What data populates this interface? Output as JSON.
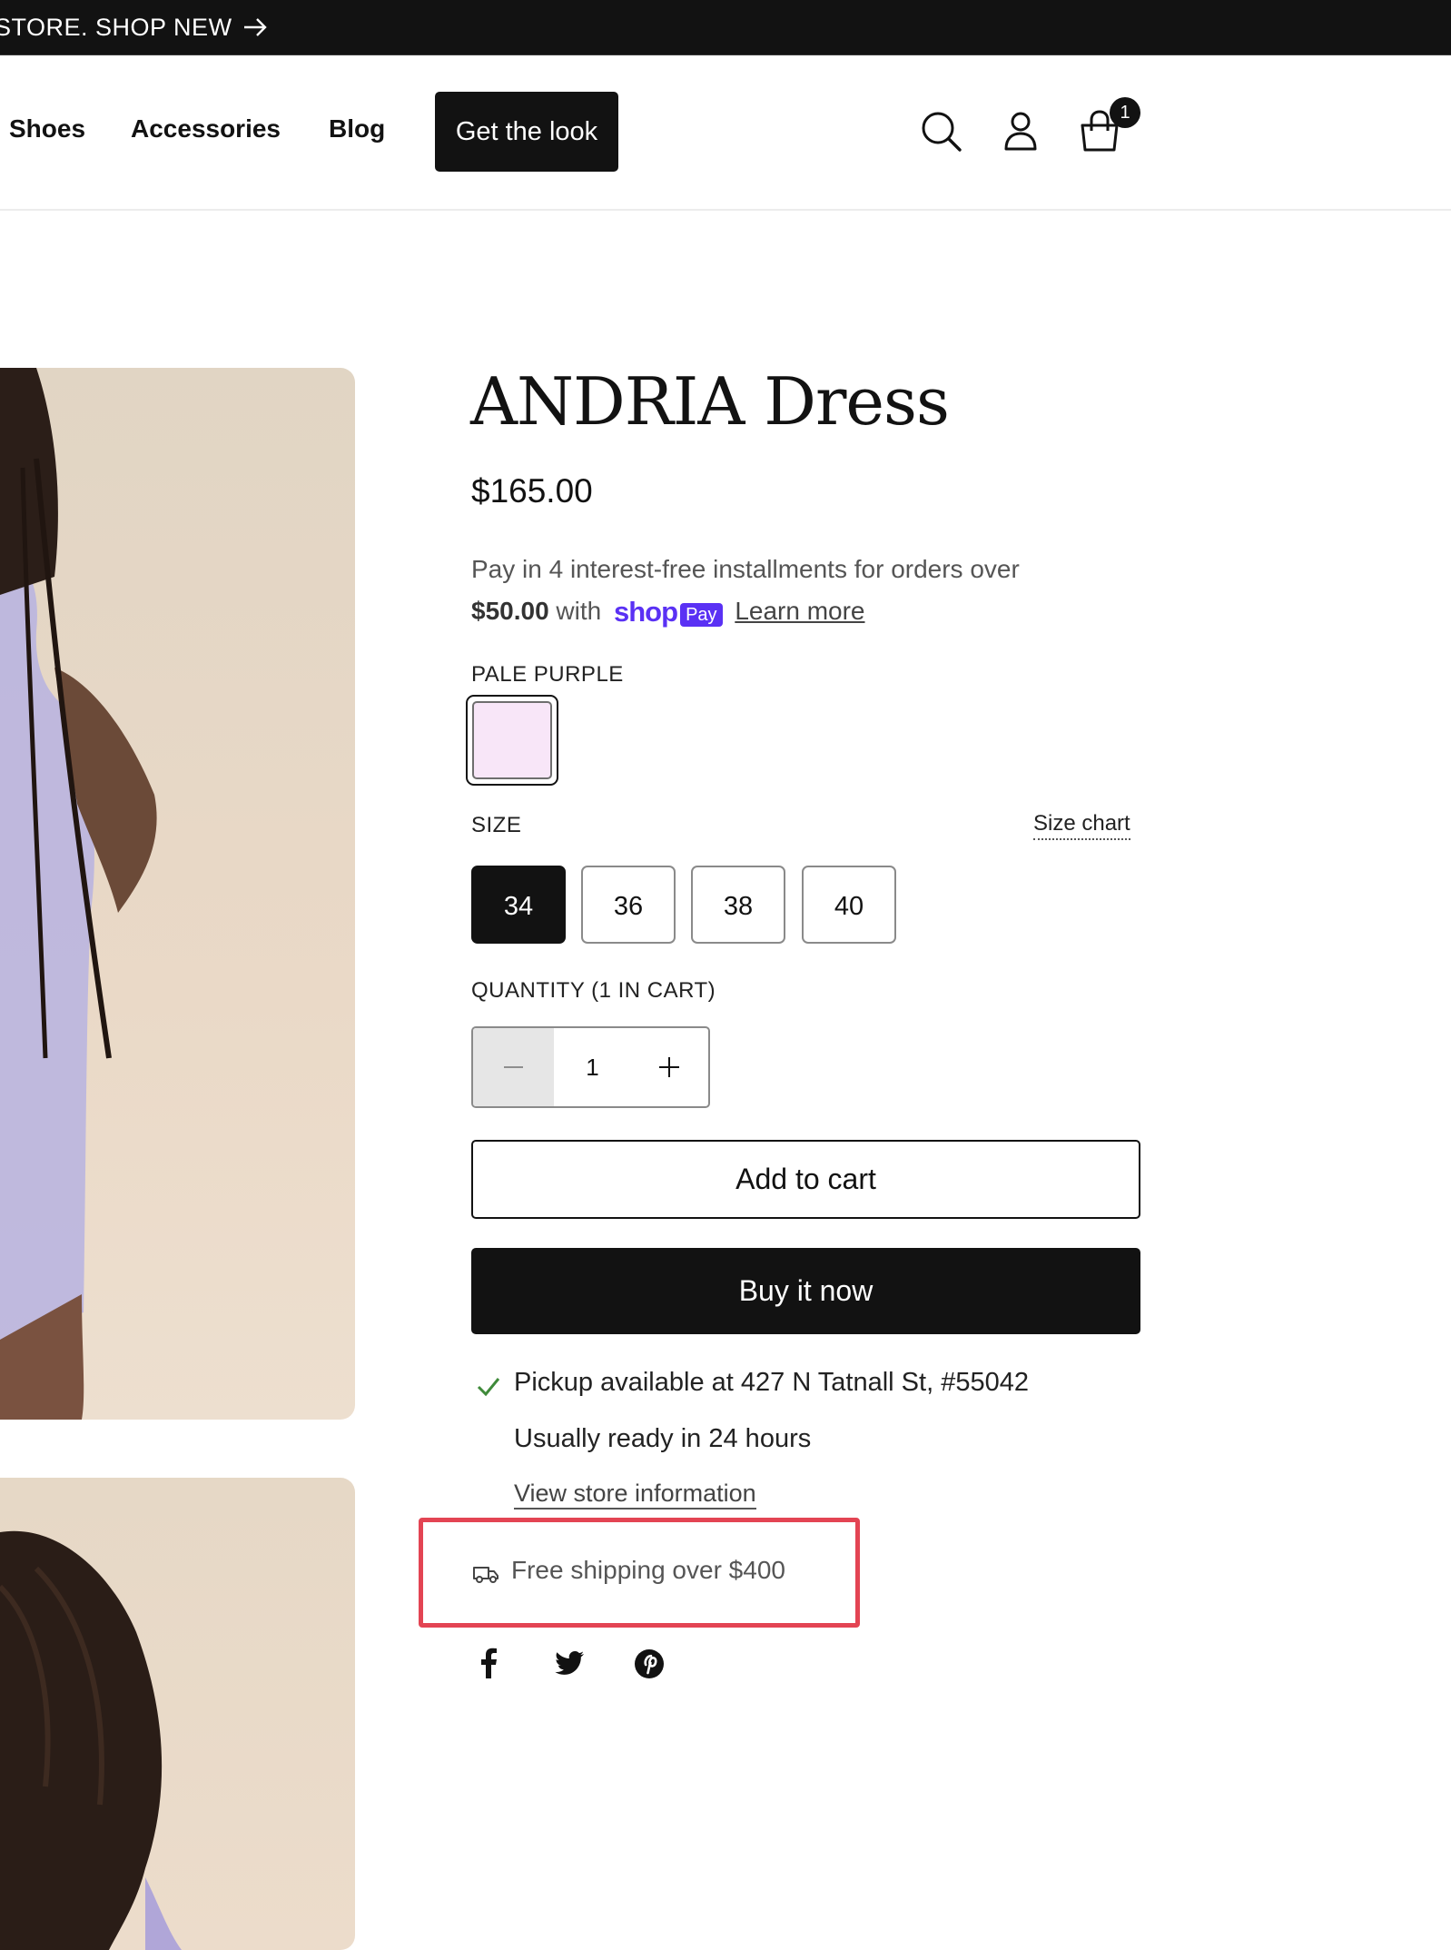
{
  "announcement": {
    "text": "STORE. SHOP NEW",
    "arrow_icon": "arrow-right-icon"
  },
  "nav": {
    "links": [
      "Shoes",
      "Accessories",
      "Blog"
    ],
    "cta": "Get the look",
    "cart_count": "1"
  },
  "product": {
    "title": "ANDRIA Dress",
    "price": "$165.00",
    "installments_text": "Pay in 4 interest-free installments for orders over",
    "installments_amount": "$50.00",
    "installments_with": "with",
    "shop_label": "shop",
    "pay_label": "Pay",
    "learn_more": "Learn more",
    "color_label": "PALE PURPLE",
    "swatch_color": "#f8e6f8",
    "size_label": "SIZE",
    "size_chart": "Size chart",
    "sizes": [
      "34",
      "36",
      "38",
      "40"
    ],
    "selected_size": "34",
    "quantity_label": "QUANTITY (1 IN CART)",
    "quantity": "1",
    "add_to_cart": "Add to cart",
    "buy_now": "Buy it now",
    "pickup": "Pickup available at 427 N Tatnall St, #55042",
    "ready": "Usually ready in 24 hours",
    "store_info": "View store information",
    "shipping": "Free shipping over $400"
  },
  "colors": {
    "accent": "#121212",
    "highlight": "#e34453",
    "shop_pay": "#5a31f4"
  }
}
